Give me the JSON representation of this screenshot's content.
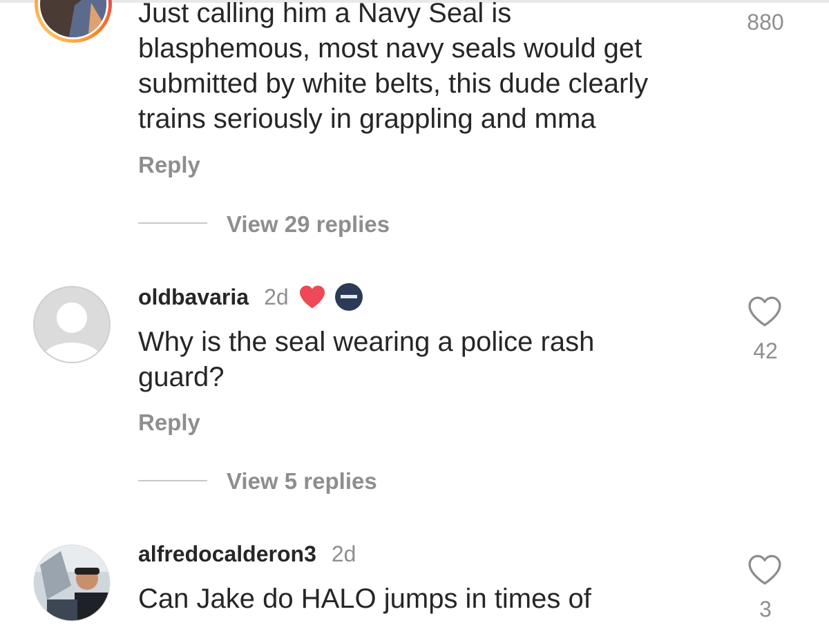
{
  "comments": [
    {
      "text": "Just calling him a Navy Seal is blasphemous, most navy seals would get submitted by white belts, this dude clearly trains seriously in grappling and mma",
      "lines": [
        "Just calling him a Navy Seal is",
        "blasphemous, most navy seals would get",
        "submitted by white belts, this dude clearly",
        "trains seriously in grappling and mma"
      ],
      "reply_label": "Reply",
      "view_replies": "View 29 replies",
      "like_count": "880"
    },
    {
      "username": "oldbavaria",
      "time": "2d",
      "lines": [
        "Why is the seal wearing a police rash",
        "guard?"
      ],
      "reply_label": "Reply",
      "view_replies": "View 5 replies",
      "like_count": "42",
      "creator_liked": true
    },
    {
      "username": "alfredocalderon3",
      "time": "2d",
      "lines": [
        "Can Jake do HALO jumps in times of"
      ],
      "like_count": "3"
    }
  ],
  "colors": {
    "heart_red": "#ed4956",
    "secondary_text": "#8e8e8e",
    "primary_text": "#262626",
    "story_ring": [
      "#feda75",
      "#fa7e1e",
      "#d62976"
    ]
  }
}
